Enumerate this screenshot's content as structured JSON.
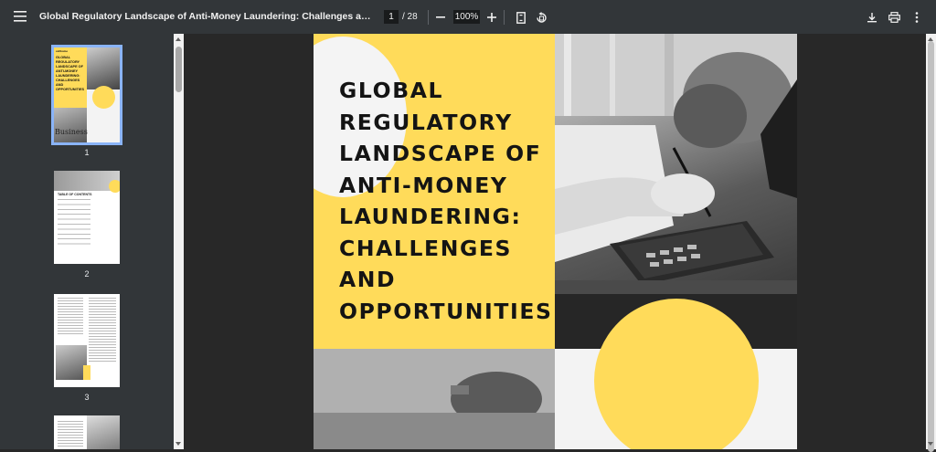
{
  "toolbar": {
    "title": "Global Regulatory Landscape of Anti-Money Laundering: Challenges and Opportunit...",
    "current_page": "1",
    "total_pages": "/ 28",
    "zoom": "100%"
  },
  "icons": {
    "menu": "menu-icon",
    "zoom_out": "minus-icon",
    "zoom_in": "plus-icon",
    "fit": "fit-page-icon",
    "rotate": "rotate-icon",
    "download": "download-icon",
    "print": "print-icon",
    "more": "more-vert-icon"
  },
  "thumbnails": [
    {
      "number": "1",
      "active": true
    },
    {
      "number": "2",
      "active": false
    },
    {
      "number": "3",
      "active": false
    }
  ],
  "page": {
    "title": "GLOBAL REGULATORY LANDSCAPE OF ANTI-MONEY LAUNDERING: CHALLENGES AND OPPORTUNITIES"
  },
  "thumb1": {
    "logo": "cellbome",
    "title": "GLOBAL REGULATORY LANDSCAPE OF ANTI-MONEY LAUNDERING: CHALLENGES AND OPPORTUNITIES",
    "business": "Business"
  },
  "thumb2": {
    "heading": "TABLE OF CONTENTS"
  },
  "colors": {
    "accent_yellow": "#ffdb5a",
    "toolbar_bg": "#323639",
    "viewer_bg": "#282828",
    "active_outline": "#8ab4f8"
  }
}
